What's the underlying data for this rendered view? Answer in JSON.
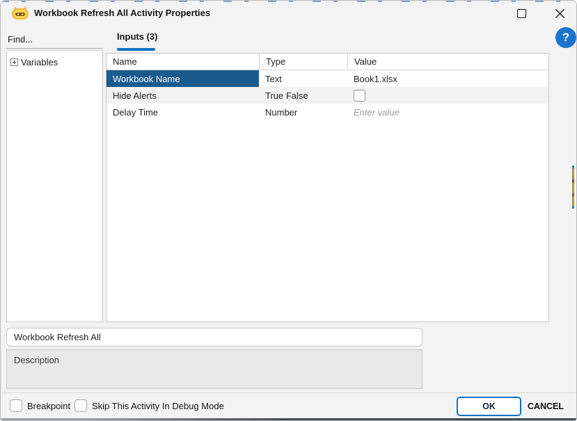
{
  "window": {
    "title": "Workbook Refresh All Activity Properties",
    "icon": "bot-icon",
    "controls": {
      "maximize": "maximize",
      "close": "close"
    }
  },
  "help": {
    "glyph": "?"
  },
  "sidebar": {
    "find_placeholder": "Find...",
    "tree": {
      "root_label": "Variables",
      "expander_state": "collapsed"
    }
  },
  "tabs": {
    "inputs": {
      "label": "Inputs (3)",
      "active": true
    }
  },
  "table": {
    "columns": {
      "name": "Name",
      "type": "Type",
      "value": "Value"
    },
    "rows": {
      "0": {
        "name": "Workbook Name",
        "type": "Text",
        "value": "Book1.xlsx",
        "selected": true
      },
      "1": {
        "name": "Hide Alerts",
        "type": "True False",
        "value_kind": "checkbox",
        "checked": false
      },
      "2": {
        "name": "Delay Time",
        "type": "Number",
        "value_placeholder": "Enter value"
      }
    }
  },
  "name_field": {
    "value": "Workbook Refresh All"
  },
  "description_field": {
    "placeholder": "Description",
    "value": ""
  },
  "footer": {
    "breakpoint": {
      "label": "Breakpoint",
      "checked": false
    },
    "skip_debug": {
      "label": "Skip This Activity In Debug Mode",
      "checked": false
    },
    "ok_label": "OK",
    "cancel_label": "CANCEL"
  },
  "colors": {
    "accent_blue": "#1173c5",
    "selection_blue": "#1b5a8c",
    "help_blue": "#1b74cf",
    "dialog_bg": "#f3f3f3",
    "alt_row_bg": "#f2f2f2"
  }
}
